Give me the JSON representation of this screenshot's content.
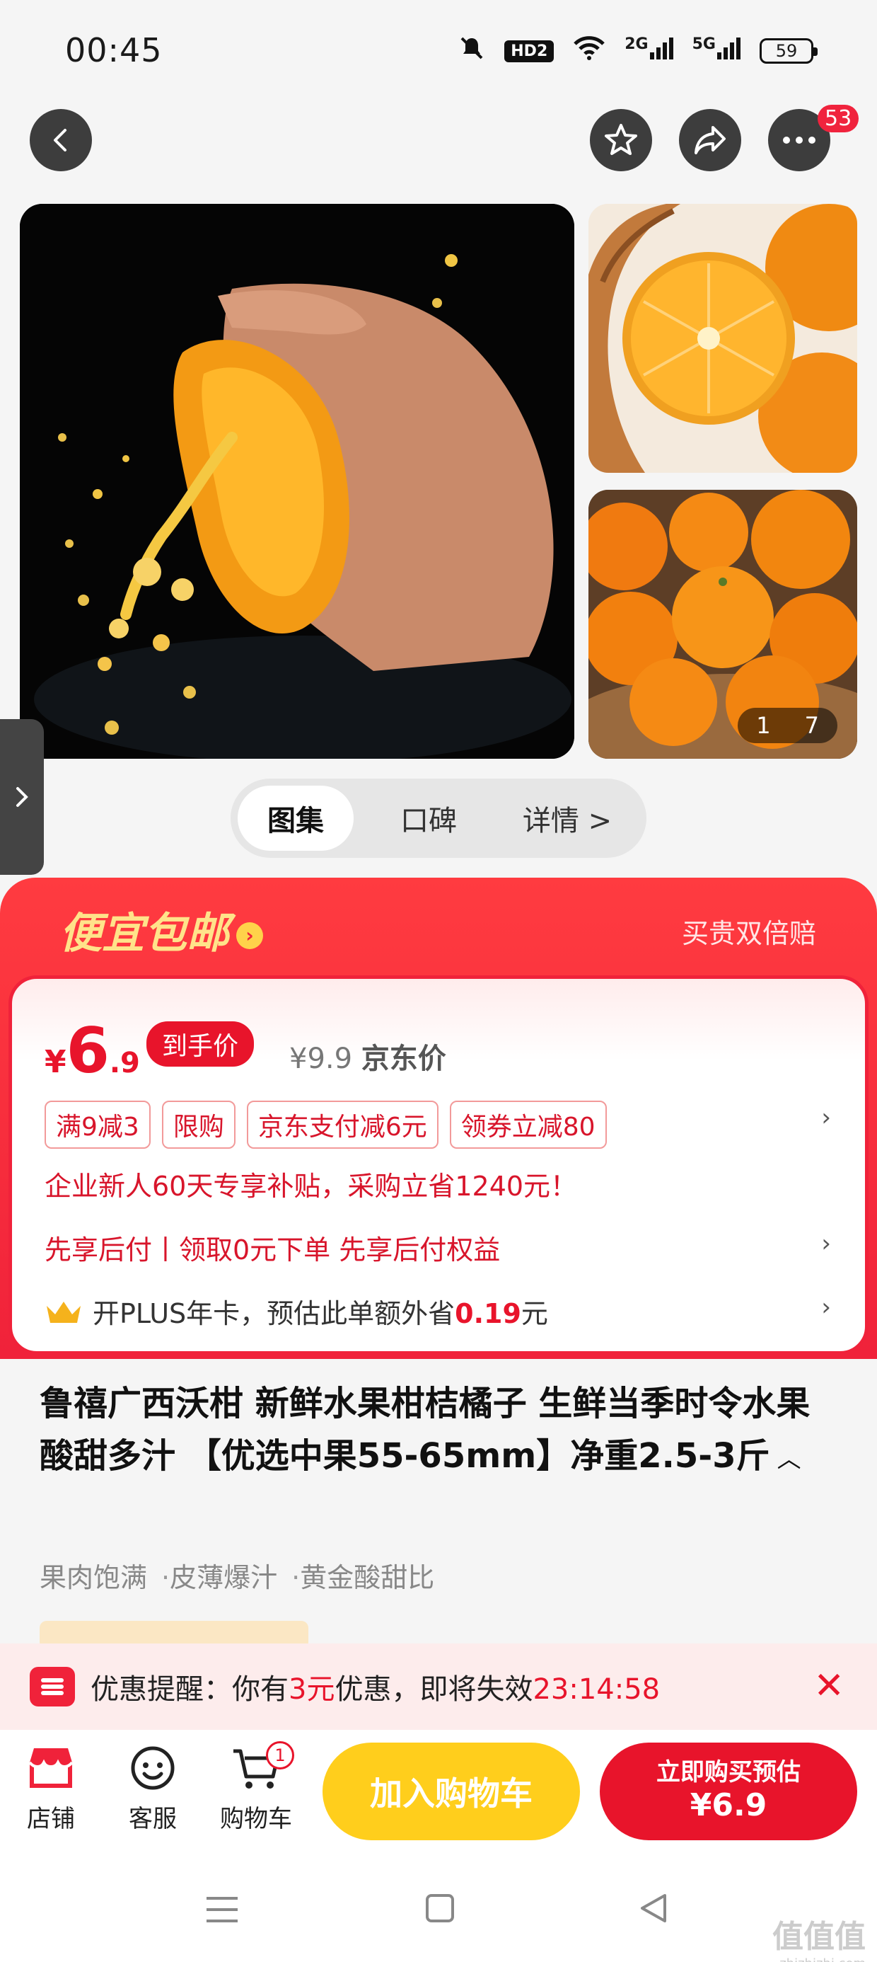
{
  "status_bar": {
    "time": "00:45",
    "hd": "HD2",
    "net1": "2G",
    "net2": "5G",
    "battery": "59"
  },
  "top_nav": {
    "more_badge": "53"
  },
  "gallery": {
    "counter_current": "1",
    "counter_total": "7"
  },
  "tabs": [
    {
      "label": "图集"
    },
    {
      "label": "口碑"
    },
    {
      "label": "详情 >"
    }
  ],
  "promo": {
    "title": "便宜包邮",
    "title_arrow": "›",
    "guarantee": "买贵双倍赔",
    "price": {
      "currency": "¥",
      "integer": "6",
      "decimal": ".9"
    },
    "price_tag": "到手价",
    "original_price": "¥9.9",
    "original_label": "京东价",
    "chips": [
      "满9减3",
      "限购",
      "京东支付减6元",
      "领券立减80"
    ],
    "enterprise_line": "企业新人60天专享补贴，采购立省1240元！",
    "pay_later_line": "先享后付丨领取0元下单 先享后付权益",
    "plus_line_prefix": "开PLUS年卡，预估此单额外省",
    "plus_amount": "0.19",
    "plus_unit": "元",
    "chevron": "›"
  },
  "product": {
    "title": "鲁禧广西沃柑 新鲜水果柑桔橘子 生鲜当季时令水果酸甜多汁 【优选中果55-65mm】净重2.5-3斤",
    "features": [
      "果肉饱满",
      "皮薄爆汁",
      "黄金酸甜比"
    ],
    "feature_sep": "·"
  },
  "reminder": {
    "prefix": "优惠提醒：你有",
    "count": "3元",
    "middle": "优惠，即将失效",
    "countdown": "23:14:58",
    "close": "✕"
  },
  "action_bar": {
    "store": "店铺",
    "service": "客服",
    "cart": "购物车",
    "cart_badge": "1",
    "add_to_cart": "加入购物车",
    "buy_now": "立即购买预估",
    "buy_price": "¥6.9"
  },
  "watermark": {
    "text": "值值值",
    "sub": "zhizhizhi.com"
  },
  "colors": {
    "accent_red": "#e8142b",
    "yellow": "#ffce1c",
    "promo_gold": "#ffe38a"
  }
}
